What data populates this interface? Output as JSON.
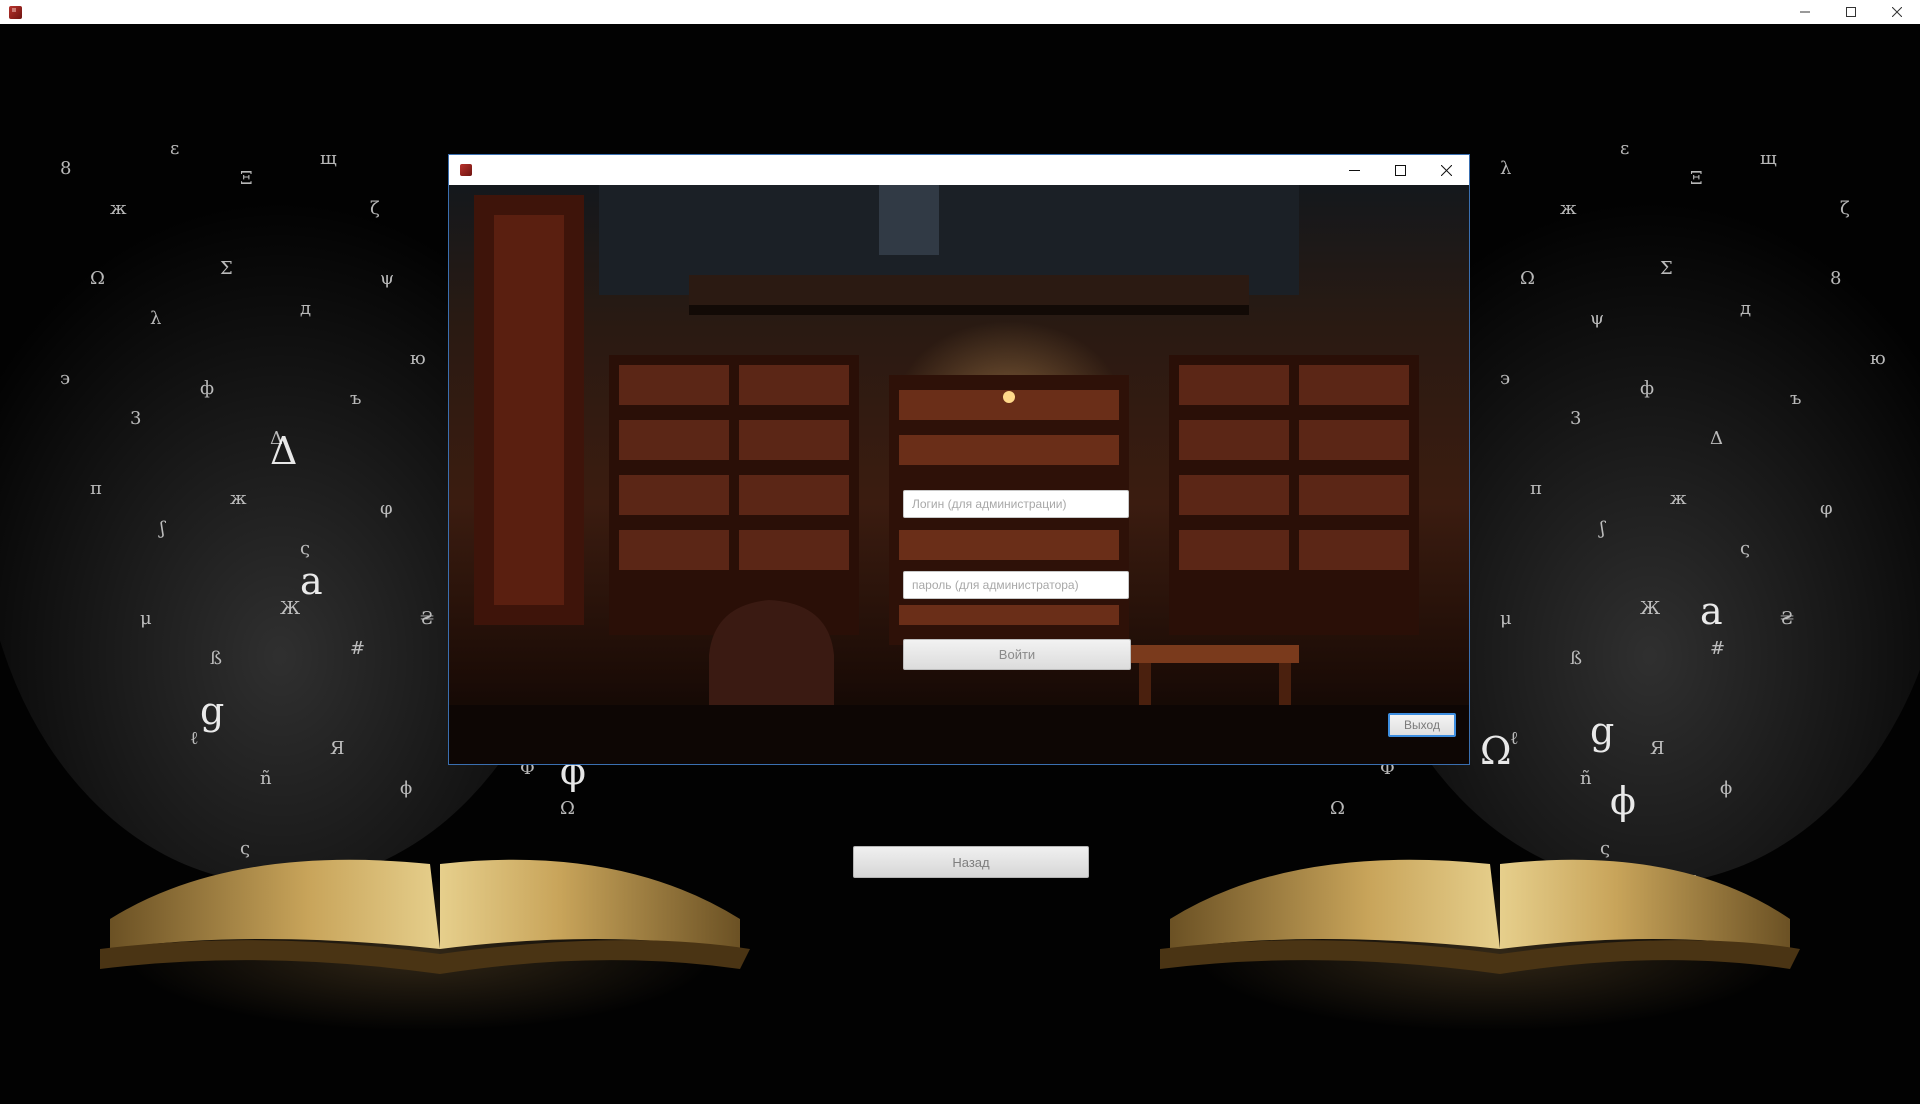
{
  "outer_window": {
    "icon": "book-app-icon",
    "controls": [
      "minimize-icon",
      "maximize-icon",
      "close-icon"
    ]
  },
  "dialog": {
    "icon": "book-app-icon",
    "controls": [
      "minimize-icon",
      "maximize-icon",
      "close-icon"
    ],
    "login_placeholder": "Логин (для администрации)",
    "password_placeholder": "пароль (для администратора)",
    "enter_label": "Войти",
    "exit_label": "Выход"
  },
  "back_label": "Назад",
  "colors": {
    "background": "#020202",
    "dialog_border": "#3a6fb0",
    "focus_border": "#3d8ee0",
    "book_gold": "#c8a45a"
  }
}
